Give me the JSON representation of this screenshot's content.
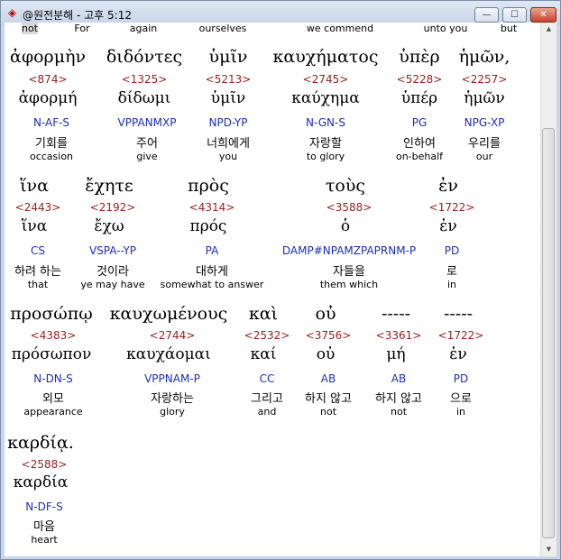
{
  "window": {
    "title": "@원전분해 - 고후 5:12",
    "min_glyph": "—",
    "max_glyph": "☐",
    "close_glyph": "✕"
  },
  "top_row": [
    "not",
    "For",
    "again",
    "ourselves",
    "we commend",
    "unto you",
    "but"
  ],
  "scroll": {
    "up_glyph": "▲",
    "down_glyph": "▼"
  },
  "rows": [
    {
      "words": [
        {
          "greek": "ἀφορμὴν",
          "strong": "<874>",
          "lemma": "ἀφορμή",
          "parsing": "N-AF-S",
          "korean": "기회를",
          "english": "occasion"
        },
        {
          "greek": "διδόντες",
          "strong": "<1325>",
          "lemma": "δίδωμι",
          "parsing": "VPPANMXP",
          "korean": "주어",
          "english": "give"
        },
        {
          "greek": "ὑμῖν",
          "strong": "<5213>",
          "lemma": "ὑμῖν",
          "parsing": "NPD-YP",
          "korean": "너희에게",
          "english": "you"
        },
        {
          "greek": "καυχήματος",
          "strong": "<2745>",
          "lemma": "καύχημα",
          "parsing": "N-GN-S",
          "korean": "자랑할",
          "english": "to glory"
        },
        {
          "greek": "ὑπὲρ",
          "strong": "<5228>",
          "lemma": "ὑπέρ",
          "parsing": "PG",
          "korean": "인하여",
          "english": "on-behalf"
        },
        {
          "greek": "ἡμῶν,",
          "strong": "<2257>",
          "lemma": "ἡμῶν",
          "parsing": "NPG-XP",
          "korean": "우리를",
          "english": "our"
        }
      ]
    },
    {
      "words": [
        {
          "greek": "ἵνα",
          "strong": "<2443>",
          "lemma": "ἵνα",
          "parsing": "CS",
          "korean": "하려 하는",
          "english": "that"
        },
        {
          "greek": "ἔχητε",
          "strong": "<2192>",
          "lemma": "ἔχω",
          "parsing": "VSPA--YP",
          "korean": "것이라",
          "english": "ye may have"
        },
        {
          "greek": "πρὸς",
          "strong": "<4314>",
          "lemma": "πρός",
          "parsing": "PA",
          "korean": "대하게",
          "english": "somewhat to answer"
        },
        {
          "greek": "τοὺς",
          "strong": "<3588>",
          "lemma": "ὁ",
          "parsing": "DAMP#NPAMZPAPRNM-P",
          "korean": "자들을",
          "english": "them which"
        },
        {
          "greek": "ἐν",
          "strong": "<1722>",
          "lemma": "ἐν",
          "parsing": "PD",
          "korean": "로",
          "english": "in"
        }
      ]
    },
    {
      "words": [
        {
          "greek": "προσώπῳ",
          "strong": "<4383>",
          "lemma": "πρόσωπον",
          "parsing": "N-DN-S",
          "korean": "외모",
          "english": "appearance"
        },
        {
          "greek": "καυχωμένους",
          "strong": "<2744>",
          "lemma": "καυχάομαι",
          "parsing": "VPPNAM-P",
          "korean": "자랑하는",
          "english": "glory"
        },
        {
          "greek": "καὶ",
          "strong": "<2532>",
          "lemma": "καί",
          "parsing": "CC",
          "korean": "그리고",
          "english": "and"
        },
        {
          "greek": "οὐ",
          "strong": "<3756>",
          "lemma": "οὐ",
          "parsing": "AB",
          "korean": "하지 않고",
          "english": "not"
        },
        {
          "greek": "-----",
          "strong": "<3361>",
          "lemma": "μή",
          "parsing": "AB",
          "korean": "하지 않고",
          "english": "not"
        },
        {
          "greek": "-----",
          "strong": "<1722>",
          "lemma": "ἐν",
          "parsing": "PD",
          "korean": "으로",
          "english": "in"
        }
      ]
    },
    {
      "words": [
        {
          "greek": "καρδίᾳ.",
          "strong": "<2588>",
          "lemma": "καρδία",
          "parsing": "N-DF-S",
          "korean": "마음",
          "english": "heart"
        }
      ]
    }
  ]
}
